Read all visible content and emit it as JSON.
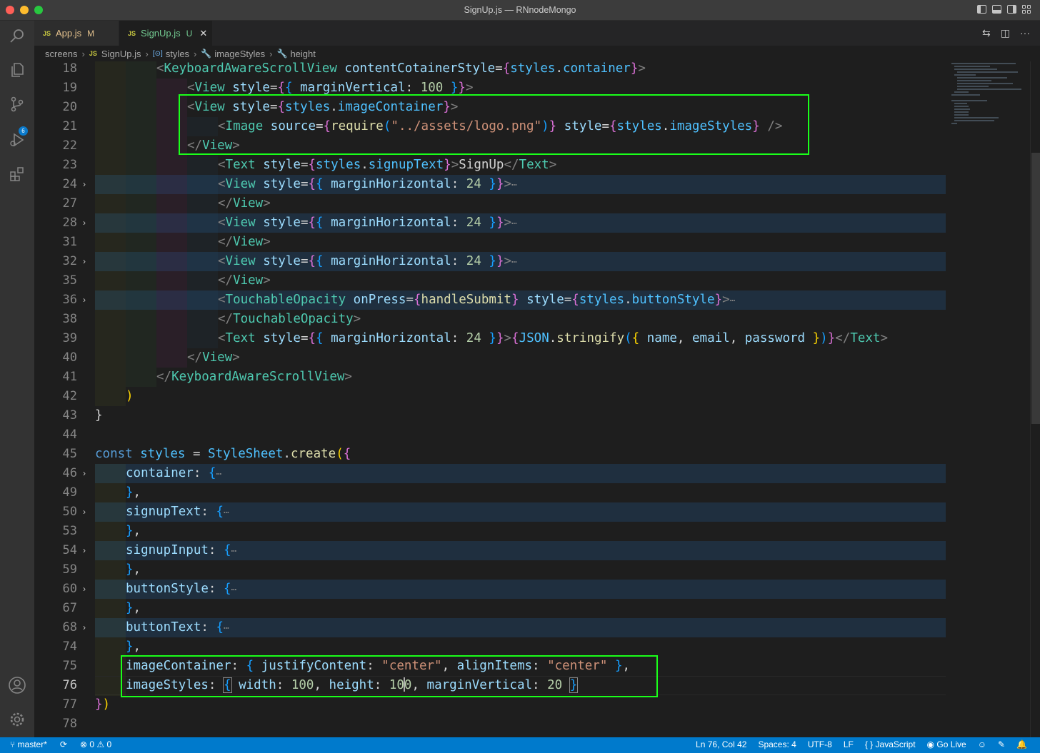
{
  "window": {
    "title": "SignUp.js — RNnodeMongo"
  },
  "activity_bar": {
    "scm_badge": "6"
  },
  "tabs": [
    {
      "icon": "JS",
      "label": "App.js",
      "status": "M"
    },
    {
      "icon": "JS",
      "label": "SignUp.js",
      "status": "U"
    }
  ],
  "breadcrumb": {
    "folder": "screens",
    "file_icon": "JS",
    "file": "SignUp.js",
    "var_icon": "[⊙]",
    "symbol1": "styles",
    "symbol2": "imageStyles",
    "symbol3": "height"
  },
  "editor": {
    "line_numbers": [
      "18",
      "19",
      "20",
      "21",
      "22",
      "23",
      "24",
      "27",
      "28",
      "31",
      "32",
      "35",
      "36",
      "38",
      "39",
      "40",
      "41",
      "42",
      "43",
      "44",
      "45",
      "46",
      "49",
      "50",
      "53",
      "54",
      "59",
      "60",
      "67",
      "68",
      "74",
      "75",
      "76",
      "77",
      "78"
    ],
    "current_line": "76"
  },
  "code": {
    "kasv_tag": "KeyboardAwareScrollView",
    "kasv_attr": "contentCotainerStyle",
    "styles": "styles",
    "container": "container",
    "view_tag": "View",
    "style_attr": "style",
    "margin_vertical": "marginVertical",
    "margin_horizontal": "marginHorizontal",
    "v100": "100",
    "v24": "24",
    "v20": "20",
    "image_container": "imageContainer",
    "image_tag": "Image",
    "source_attr": "source",
    "require_fn": "require",
    "logo_path": "\"../assets/logo.png\"",
    "image_styles": "imageStyles",
    "text_tag": "Text",
    "signup_text": "signupText",
    "signup_label": "SignUp",
    "touchable_tag": "TouchableOpacity",
    "onpress_attr": "onPress",
    "handle_submit": "handleSubmit",
    "button_style": "buttonStyle",
    "json_obj": "JSON",
    "stringify_fn": "stringify",
    "name": "name",
    "email": "email",
    "password": "password",
    "const_kw": "const",
    "stylesheet": "StyleSheet",
    "create_fn": "create",
    "signup_input": "signupInput",
    "button_text": "buttonText",
    "justify_content": "justifyContent",
    "align_items": "alignItems",
    "center": "\"center\"",
    "width": "width",
    "height": "height",
    "height_a": "10",
    "height_b": "0"
  },
  "status_bar": {
    "branch": "master*",
    "errors": "0",
    "warnings": "0",
    "position": "Ln 76, Col 42",
    "spaces": "Spaces: 4",
    "encoding": "UTF-8",
    "eol": "LF",
    "language": "JavaScript",
    "go_live": "Go Live"
  }
}
